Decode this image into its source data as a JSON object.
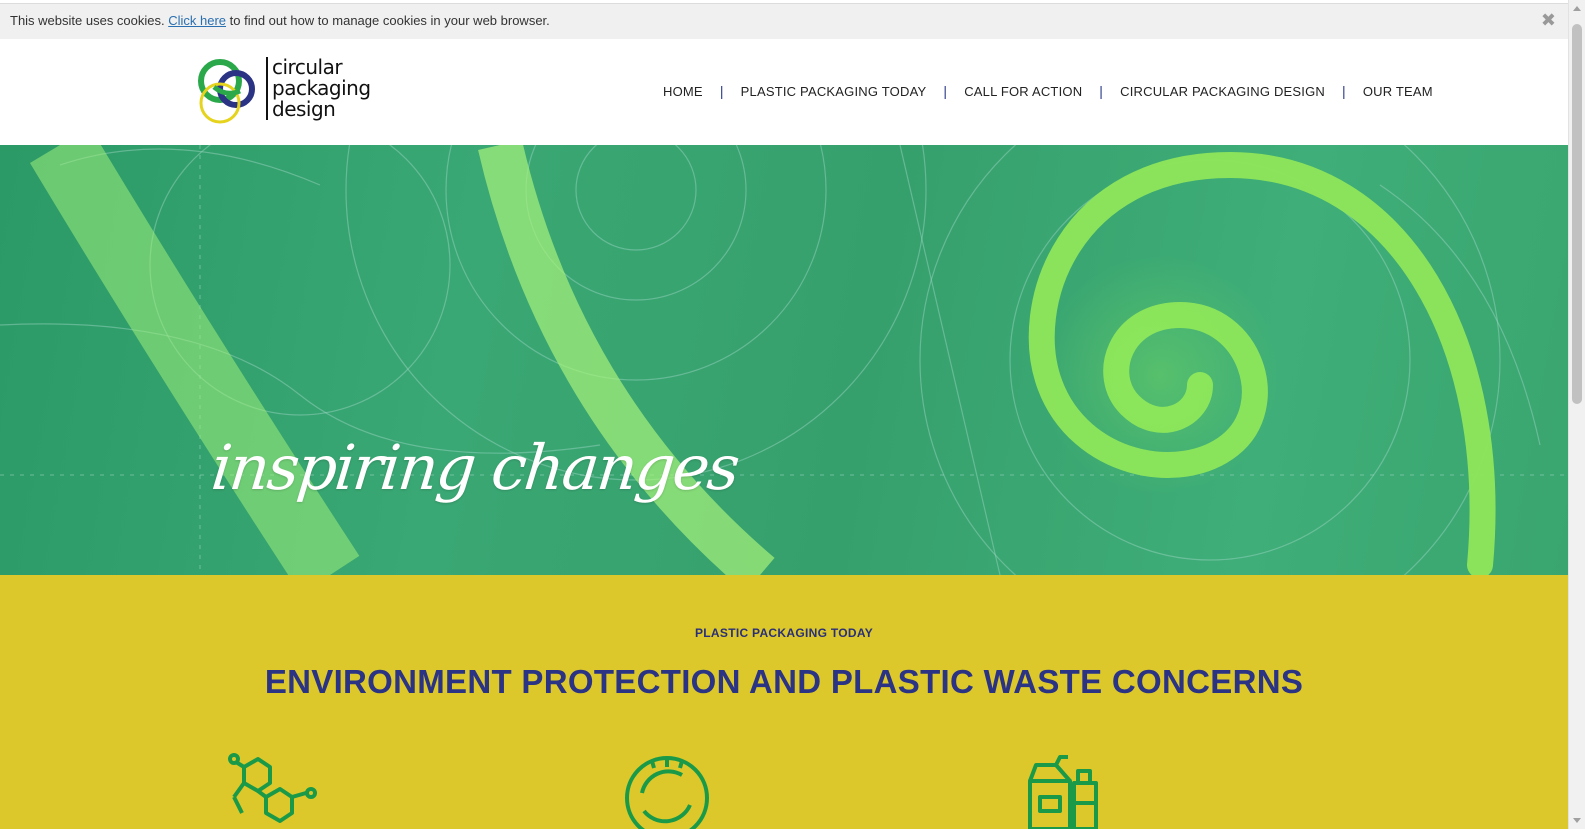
{
  "cookie_bar": {
    "text_before": "This website uses cookies. ",
    "link_text": "Click here",
    "text_after": " to find out how to manage cookies in your web browser.",
    "close_symbol": "✖"
  },
  "logo": {
    "line1": "circular",
    "line2": "packaging",
    "line3": "design"
  },
  "nav": {
    "items": [
      {
        "label": "HOME"
      },
      {
        "label": "PLASTIC PACKAGING TODAY"
      },
      {
        "label": "CALL FOR ACTION"
      },
      {
        "label": "CIRCULAR PACKAGING DESIGN"
      },
      {
        "label": "OUR TEAM"
      }
    ],
    "separator": "|"
  },
  "hero": {
    "title": "inspiring changes"
  },
  "section": {
    "eyebrow": "PLASTIC PACKAGING TODAY",
    "headline": "ENVIRONMENT PROTECTION AND PLASTIC WASTE CONCERNS",
    "icons": [
      "molecule-icon",
      "gauge-icon",
      "containers-icon"
    ]
  },
  "colors": {
    "cookie_bg": "#f0f0f0",
    "nav_separator": "#2a3a8a",
    "hero_green": "#3aa874",
    "section_yellow": "#dcc82a",
    "headline_navy": "#2b3384",
    "icon_green": "#1a9a48",
    "logo_green": "#2aa84a",
    "logo_navy": "#2b3384",
    "logo_yellow": "#e6d31e"
  }
}
